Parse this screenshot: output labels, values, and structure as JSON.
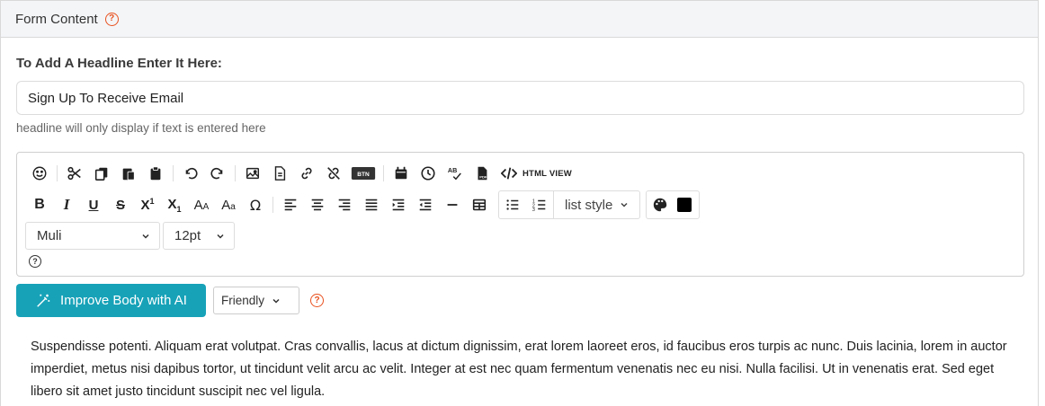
{
  "panel": {
    "title": "Form Content",
    "help_glyph": "?"
  },
  "headline": {
    "label": "To Add A Headline Enter It Here:",
    "value": "Sign Up To Receive Email",
    "hint": "headline will only display if text is entered here"
  },
  "toolbar": {
    "btn_label": "BTN",
    "html_view_label": "HTML VIEW",
    "list_style_label": "list style",
    "font_family": "Muli",
    "font_size": "12pt",
    "help_glyph": "?",
    "text_color": "#000000",
    "row1_icons": [
      "emoji-icon",
      "cut-icon",
      "copy-icon",
      "paste-icon",
      "paste-text-icon",
      "undo-icon",
      "redo-icon",
      "image-icon",
      "document-icon",
      "link-icon",
      "unlink-icon",
      "button-icon",
      "calendar-icon",
      "clock-icon",
      "spellcheck-icon",
      "pdf-icon",
      "code-icon"
    ],
    "row2_icons": [
      "bold-icon",
      "italic-icon",
      "underline-icon",
      "strikethrough-icon",
      "superscript-icon",
      "subscript-icon",
      "uppercase-icon",
      "lowercase-icon",
      "omega-icon",
      "align-left-icon",
      "align-center-icon",
      "align-right-icon",
      "justify-icon",
      "indent-icon",
      "outdent-icon",
      "horizontal-rule-icon",
      "table-icon",
      "bullet-list-icon",
      "numbered-list-icon",
      "palette-icon"
    ]
  },
  "ai": {
    "button_label": "Improve Body with AI",
    "tone": "Friendly",
    "accent": "#17a2b8"
  },
  "body": {
    "text": "Suspendisse potenti. Aliquam erat volutpat. Cras convallis, lacus at dictum dignissim, erat lorem laoreet eros, id faucibus eros turpis ac nunc. Duis lacinia, lorem in auctor imperdiet, metus nisi dapibus tortor, ut tincidunt velit arcu ac velit. Integer at est nec quam fermentum venenatis nec eu nisi. Nulla facilisi. Ut in venenatis erat. Sed eget libero sit amet justo tincidunt suscipit nec vel ligula."
  }
}
